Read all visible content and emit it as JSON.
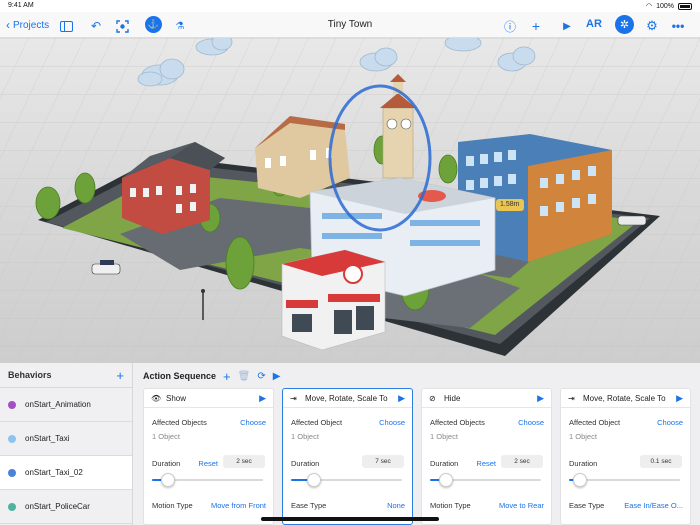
{
  "status": {
    "time": "9:41 AM",
    "battery": "100%"
  },
  "nav": {
    "back_label": "Projects",
    "title": "Tiny Town",
    "ar_label": "AR"
  },
  "scene": {
    "measure_label": "1.58m"
  },
  "behaviors": {
    "title": "Behaviors",
    "items": [
      {
        "label": "onStart_Animation",
        "color": "#a34fc3"
      },
      {
        "label": "onStart_Taxi",
        "color": "#8ec2ef"
      },
      {
        "label": "onStart_Taxi_02",
        "color": "#4a83d9"
      },
      {
        "label": "onStart_PoliceCar",
        "color": "#4fb3a2"
      }
    ]
  },
  "sequence": {
    "title": "Action Sequence",
    "cards": [
      {
        "title": "Show",
        "objects_label": "Affected Objects",
        "objects_action": "Choose",
        "objects_count": "1 Object",
        "duration_label": "Duration",
        "duration_reset": "Reset",
        "duration_value": "2 sec",
        "duration_level": 0.05,
        "option_label": "Motion Type",
        "option_value": "Move from Front"
      },
      {
        "title": "Move, Rotate, Scale To",
        "objects_label": "Affected Object",
        "objects_action": "Choose",
        "objects_count": "1 Object",
        "duration_label": "Duration",
        "duration_value": "7 sec",
        "duration_level": 0.12,
        "option_label": "Ease Type",
        "option_value": "None"
      },
      {
        "title": "Hide",
        "objects_label": "Affected Objects",
        "objects_action": "Choose",
        "objects_count": "1 Object",
        "duration_label": "Duration",
        "duration_reset": "Reset",
        "duration_value": "2 sec",
        "duration_level": 0.05,
        "option_label": "Motion Type",
        "option_value": "Move to Rear"
      },
      {
        "title": "Move, Rotate, Scale To",
        "objects_label": "Affected Object",
        "objects_action": "Choose",
        "objects_count": "1 Object",
        "duration_label": "Duration",
        "duration_value": "0.1 sec",
        "duration_level": 0.0,
        "option_label": "Ease Type",
        "option_value": "Ease In/Ease O..."
      }
    ]
  }
}
